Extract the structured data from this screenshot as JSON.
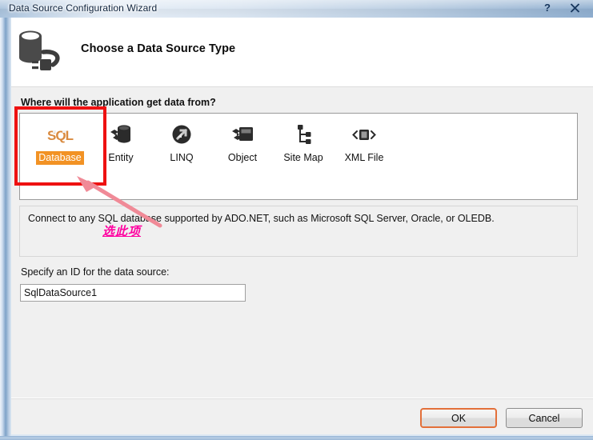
{
  "window": {
    "title": "Data Source Configuration Wizard",
    "help_button": "?",
    "close_button": "close-icon",
    "accent_orange": "#f29224",
    "annotation_red": "#ee1111",
    "annotation_magenta": "#ff00a0"
  },
  "header": {
    "icon": "database-plug-icon",
    "title": "Choose a Data Source Type"
  },
  "main": {
    "prompt_label": "Where will the application get data from?",
    "sources": [
      {
        "label": "Database",
        "icon": "sql-database-icon",
        "selected": true
      },
      {
        "label": "Entity",
        "icon": "entity-cylinder-icon",
        "selected": false
      },
      {
        "label": "LINQ",
        "icon": "linq-circle-arrow-icon",
        "selected": false
      },
      {
        "label": "Object",
        "icon": "object-box-icon",
        "selected": false
      },
      {
        "label": "Site Map",
        "icon": "site-map-tree-icon",
        "selected": false
      },
      {
        "label": "XML File",
        "icon": "xml-file-icon",
        "selected": false
      }
    ],
    "description": "Connect to any SQL database supported by ADO.NET, such as Microsoft SQL Server, Oracle, or OLEDB.",
    "id_label": "Specify an ID for the data source:",
    "id_value": "SqlDataSource1",
    "id_placeholder": "SqlDataSource1"
  },
  "footer": {
    "ok_label": "OK",
    "cancel_label": "Cancel"
  },
  "annotations": {
    "chinese_note": "选此项"
  }
}
